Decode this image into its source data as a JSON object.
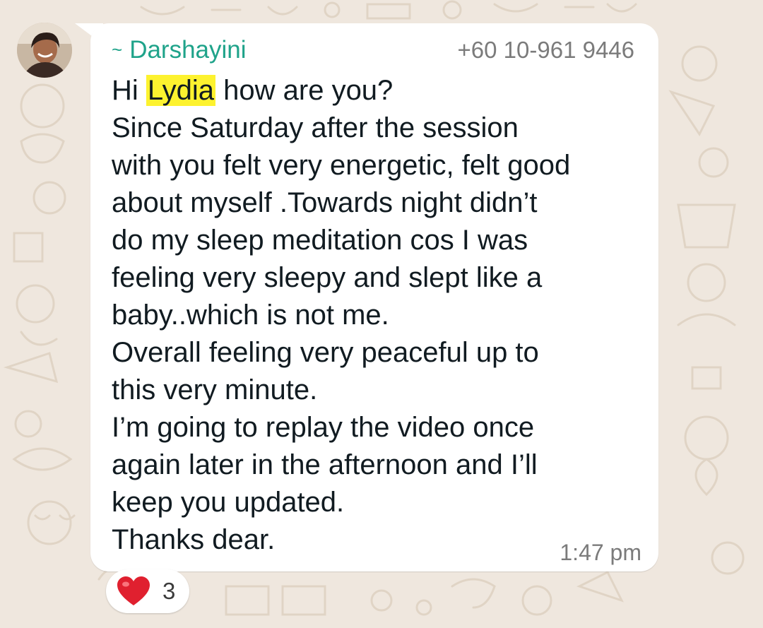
{
  "message": {
    "sender_prefix": "~",
    "sender_name": "Darshayini",
    "sender_phone": "+60 10-961 9446",
    "greeting_start": "Hi ",
    "mention": "Lydia",
    "greeting_end": " how are you?",
    "lines": [
      "Since Saturday after the session",
      "with you felt very energetic, felt good",
      "about myself .Towards night didn’t",
      "do my sleep meditation cos I was",
      "feeling very sleepy and slept like a",
      "baby..which is not me.",
      "Overall feeling very peaceful up to",
      "this very minute.",
      "I’m going to replay the video once",
      "again later in the afternoon and I’ll",
      "keep you updated.",
      "Thanks dear."
    ],
    "time": "1:47 pm"
  },
  "reaction": {
    "icon": "red-heart-icon",
    "count": "3"
  },
  "colors": {
    "sender_name": "#1fa38a",
    "wallpaper": "#efe7de",
    "mention_highlight": "#fdf22f",
    "heart": "#e0202f"
  }
}
